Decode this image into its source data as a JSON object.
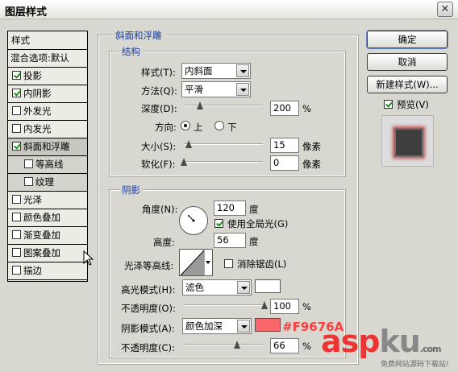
{
  "window": {
    "title": "图层样式",
    "close_glyph": "✕"
  },
  "styles_panel": {
    "header": "样式",
    "blend_options": "混合选项:默认",
    "items": [
      {
        "label": "投影",
        "checked": true
      },
      {
        "label": "内阴影",
        "checked": true
      },
      {
        "label": "外发光",
        "checked": false
      },
      {
        "label": "内发光",
        "checked": false
      },
      {
        "label": "斜面和浮雕",
        "checked": true
      },
      {
        "label": "等高线",
        "checked": false
      },
      {
        "label": "纹理",
        "checked": false
      },
      {
        "label": "光泽",
        "checked": false
      },
      {
        "label": "颜色叠加",
        "checked": false
      },
      {
        "label": "渐变叠加",
        "checked": false
      },
      {
        "label": "图案叠加",
        "checked": false
      },
      {
        "label": "描边",
        "checked": false
      }
    ]
  },
  "bevel": {
    "group_title": "斜面和浮雕",
    "structure": {
      "title": "结构",
      "style_label": "样式(T):",
      "style_value": "内斜面",
      "technique_label": "方法(Q):",
      "technique_value": "平滑",
      "depth_label": "深度(D):",
      "depth_value": "200",
      "depth_unit": "%",
      "direction_label": "方向:",
      "direction_up": "上",
      "direction_down": "下",
      "size_label": "大小(S):",
      "size_value": "15",
      "size_unit": "像素",
      "soften_label": "软化(F):",
      "soften_value": "0",
      "soften_unit": "像素"
    },
    "shading": {
      "title": "阴影",
      "angle_label": "角度(N):",
      "angle_value": "120",
      "angle_unit": "度",
      "global_light_label": "使用全局光(G)",
      "altitude_label": "高度:",
      "altitude_value": "56",
      "altitude_unit": "度",
      "gloss_contour_label": "光泽等高线:",
      "anti_aliased_label": "消除锯齿(L)",
      "highlight_mode_label": "高光模式(H):",
      "highlight_mode_value": "滤色",
      "highlight_opacity_label": "不透明度(O):",
      "highlight_opacity_value": "100",
      "shadow_mode_label": "阴影模式(A):",
      "shadow_mode_value": "颜色加深",
      "shadow_opacity_label": "不透明度(C):",
      "shadow_opacity_value": "66",
      "percent": "%"
    },
    "levels": {
      "depth": 0.2,
      "size": 0.06,
      "soften": 0.0,
      "highlight_opacity": 1.0,
      "shadow_opacity": 0.66
    },
    "colors": {
      "highlight": "#ffffff",
      "shadow": "#f9676a"
    }
  },
  "buttons": {
    "ok": "确定",
    "cancel": "取消",
    "new_style": "新建样式(W)...",
    "preview": "预览(V)"
  },
  "annotation": "#F9676A",
  "watermark": {
    "main": "asp",
    "ku": "ku",
    "suffix": ".com",
    "sub": "免费网站源码下载站!"
  }
}
